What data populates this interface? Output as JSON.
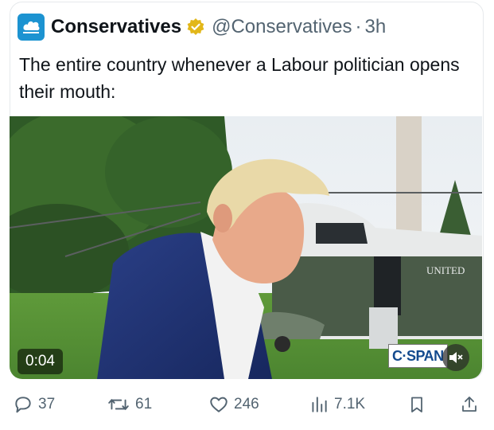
{
  "post": {
    "account_name": "Conservatives",
    "handle": "@Conservatives",
    "separator": "·",
    "time_ago": "3h",
    "text": "The entire country whenever a Labour politician opens their mouth:"
  },
  "media": {
    "duration": "0:04",
    "broadcaster": "C·SPAN",
    "aircraft_text": "UNITED"
  },
  "actions": {
    "replies": "37",
    "reposts": "61",
    "likes": "246",
    "views": "7.1K"
  },
  "colors": {
    "brand_blue": "#1c93d1",
    "verified_gold": "#e2b719",
    "secondary_text": "#536471"
  }
}
